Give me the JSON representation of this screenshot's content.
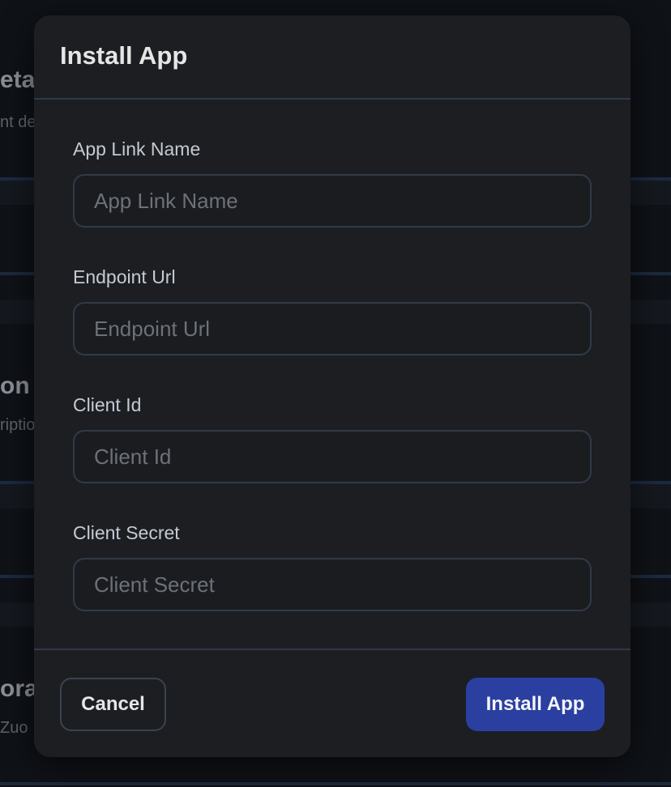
{
  "background": {
    "sections": [
      {
        "heading": "eta",
        "sub": "nt de"
      },
      {
        "heading": "on",
        "sub": "riptio"
      },
      {
        "heading": "ora",
        "sub": "Zuo"
      }
    ]
  },
  "modal": {
    "title": "Install App",
    "fields": [
      {
        "label": "App Link Name",
        "placeholder": "App Link Name",
        "value": ""
      },
      {
        "label": "Endpoint Url",
        "placeholder": "Endpoint Url",
        "value": ""
      },
      {
        "label": "Client Id",
        "placeholder": "Client Id",
        "value": ""
      },
      {
        "label": "Client Secret",
        "placeholder": "Client Secret",
        "value": ""
      }
    ],
    "cancel_label": "Cancel",
    "install_label": "Install App"
  },
  "colors": {
    "modal_bg": "#1c1e22",
    "primary_button": "#2b3fa0",
    "divider": "#2e3a4a"
  }
}
